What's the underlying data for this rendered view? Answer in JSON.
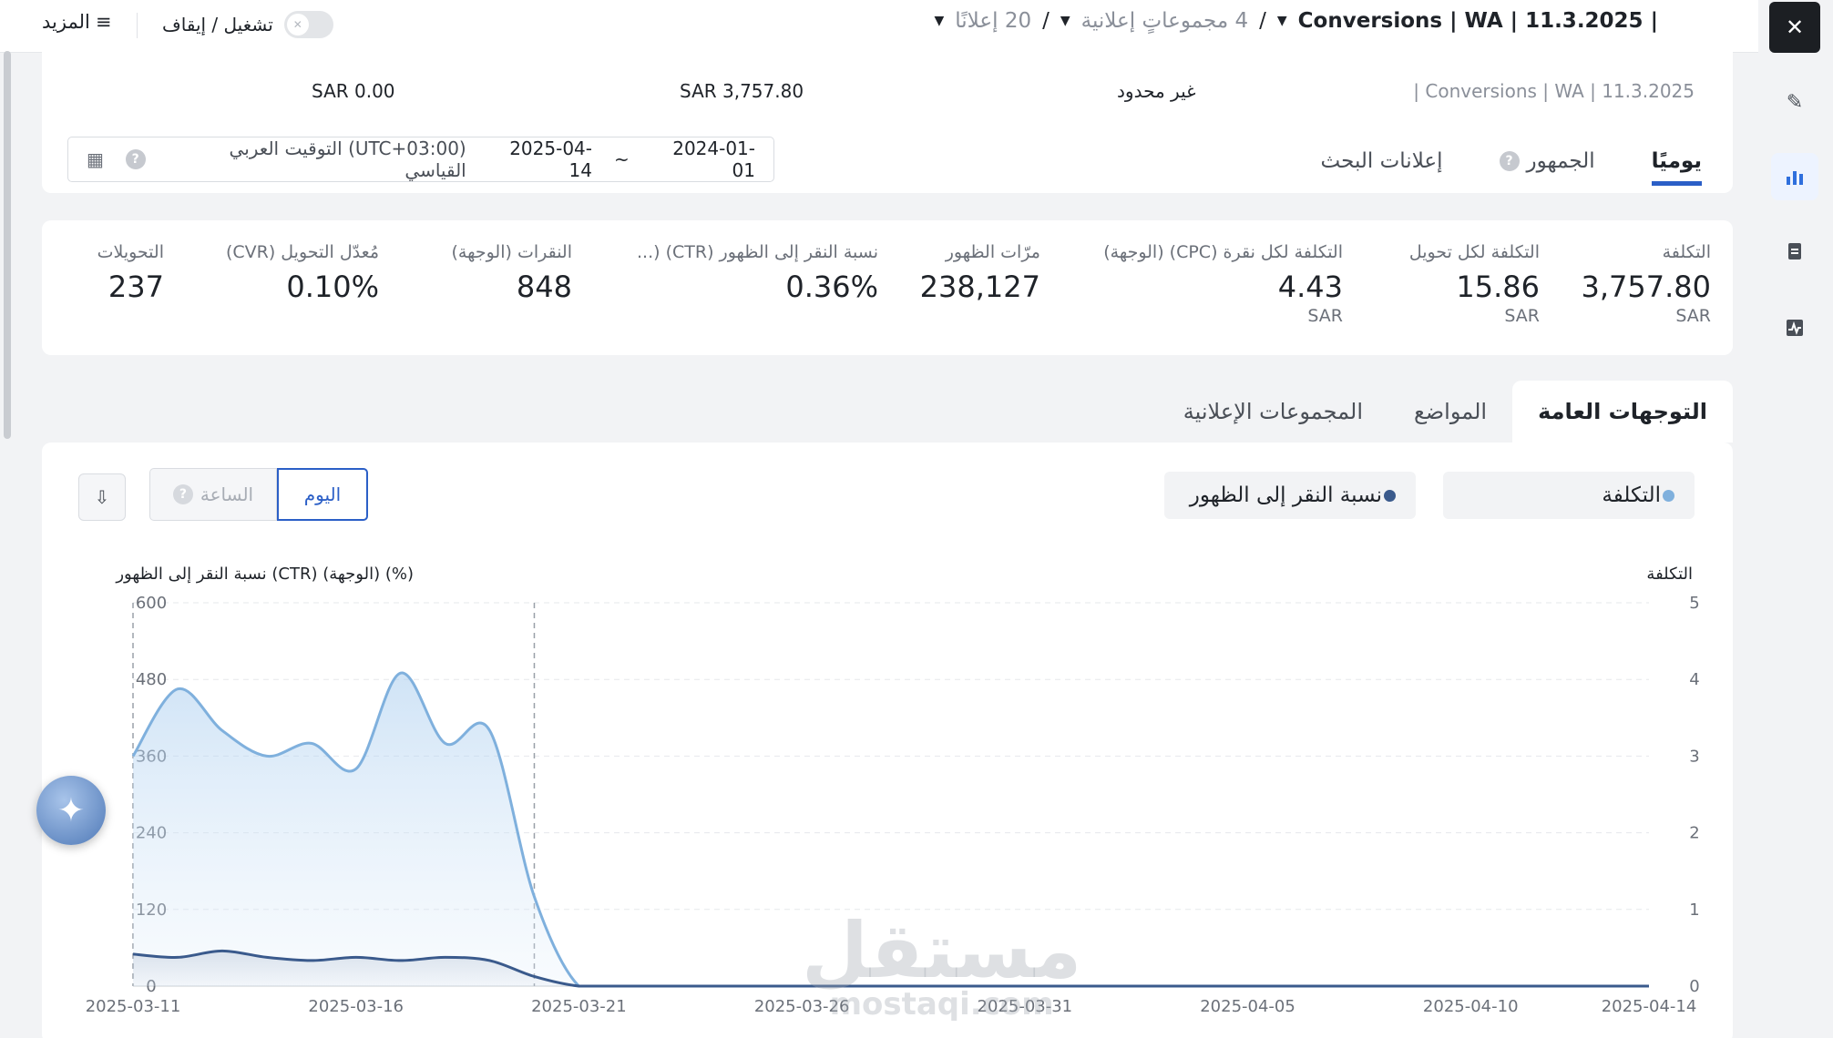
{
  "topbar": {
    "more_label": "المزيد",
    "toggle_label": "تشغيل / إيقاف",
    "campaign": "| Conversions | WA | 11.3.2025",
    "ad_groups": "4 مجموعاتٍ إعلانية",
    "ads": "20 إعلانًا",
    "slash": "/"
  },
  "summary": {
    "campaign_name": "| Conversions | WA | 11.3.2025",
    "budget": "غير محدود",
    "spend": "SAR 3,757.80",
    "value": "SAR 0.00",
    "date_start": "2024-01-01",
    "date_sep": "~",
    "date_end": "2025-04-14",
    "timezone": "(UTC+03:00) التوقيت العربي القياسي",
    "tabs": [
      {
        "label": "يوميًا"
      },
      {
        "label": "الجمهور"
      },
      {
        "label": "إعلانات البحث"
      }
    ]
  },
  "metrics": [
    {
      "label": "التكلفة",
      "value": "3,757.80",
      "currency": "SAR"
    },
    {
      "label": "التكلفة لكل تحويل",
      "value": "15.86",
      "currency": "SAR"
    },
    {
      "label": "التكلفة لكل نقرة (CPC) (الوجهة)",
      "value": "4.43",
      "currency": "SAR"
    },
    {
      "label": "مرّات الظهور",
      "value": "238,127",
      "currency": ""
    },
    {
      "label": "نسبة النقر إلى الظهور (CTR) (...",
      "value": "0.36%",
      "currency": ""
    },
    {
      "label": "النقرات (الوجهة)",
      "value": "848",
      "currency": ""
    },
    {
      "label": "مُعدّل التحويل (CVR)",
      "value": "0.10%",
      "currency": ""
    },
    {
      "label": "التحويلات",
      "value": "237",
      "currency": ""
    }
  ],
  "section_tabs": [
    {
      "label": "التوجهات العامة"
    },
    {
      "label": "المواضع"
    },
    {
      "label": "المجموعات الإعلانية"
    }
  ],
  "controls": {
    "day_label": "اليوم",
    "hour_label": "الساعة",
    "metric_pill_1": "التكلفة",
    "metric_pill_2": "نسبة النقر إلى الظهور"
  },
  "colors": {
    "cost_series": "#7fb0dd",
    "ctr_series": "#3a5a8c",
    "accent": "#2b5fc7"
  },
  "chart_data": {
    "type": "area",
    "title": "",
    "y_left_label": "نسبة النقر إلى الظهور (CTR) (الوجهة) (%)",
    "y_right_label": "التكلفة",
    "y_left_ticks": [
      "0",
      "120",
      "240",
      "360",
      "480",
      "600"
    ],
    "y_right_ticks": [
      "0",
      "1",
      "2",
      "3",
      "4",
      "5"
    ],
    "x_ticks": [
      "2025-03-11",
      "2025-03-16",
      "2025-03-21",
      "2025-03-26",
      "2025-03-31",
      "2025-04-05",
      "2025-04-10",
      "2025-04-14"
    ],
    "ylim_left": [
      0,
      600
    ],
    "ylim_right": [
      0,
      5
    ],
    "grid": true,
    "x": [
      "2025-03-11",
      "2025-03-12",
      "2025-03-13",
      "2025-03-14",
      "2025-03-15",
      "2025-03-16",
      "2025-03-17",
      "2025-03-18",
      "2025-03-19",
      "2025-03-20",
      "2025-03-21",
      "2025-03-22",
      "2025-03-24",
      "2025-03-26",
      "2025-03-31",
      "2025-04-05",
      "2025-04-10",
      "2025-04-14"
    ],
    "series": [
      {
        "name": "التكلفة",
        "axis": "left",
        "values": [
          360,
          465,
          400,
          360,
          380,
          340,
          490,
          380,
          400,
          140,
          0,
          0,
          0,
          0,
          0,
          0,
          0,
          0
        ]
      },
      {
        "name": "نسبة النقر إلى الظهور",
        "axis": "left",
        "values": [
          50,
          45,
          55,
          45,
          40,
          45,
          40,
          45,
          40,
          15,
          0,
          0,
          0,
          0,
          0,
          0,
          0,
          0
        ]
      }
    ]
  }
}
